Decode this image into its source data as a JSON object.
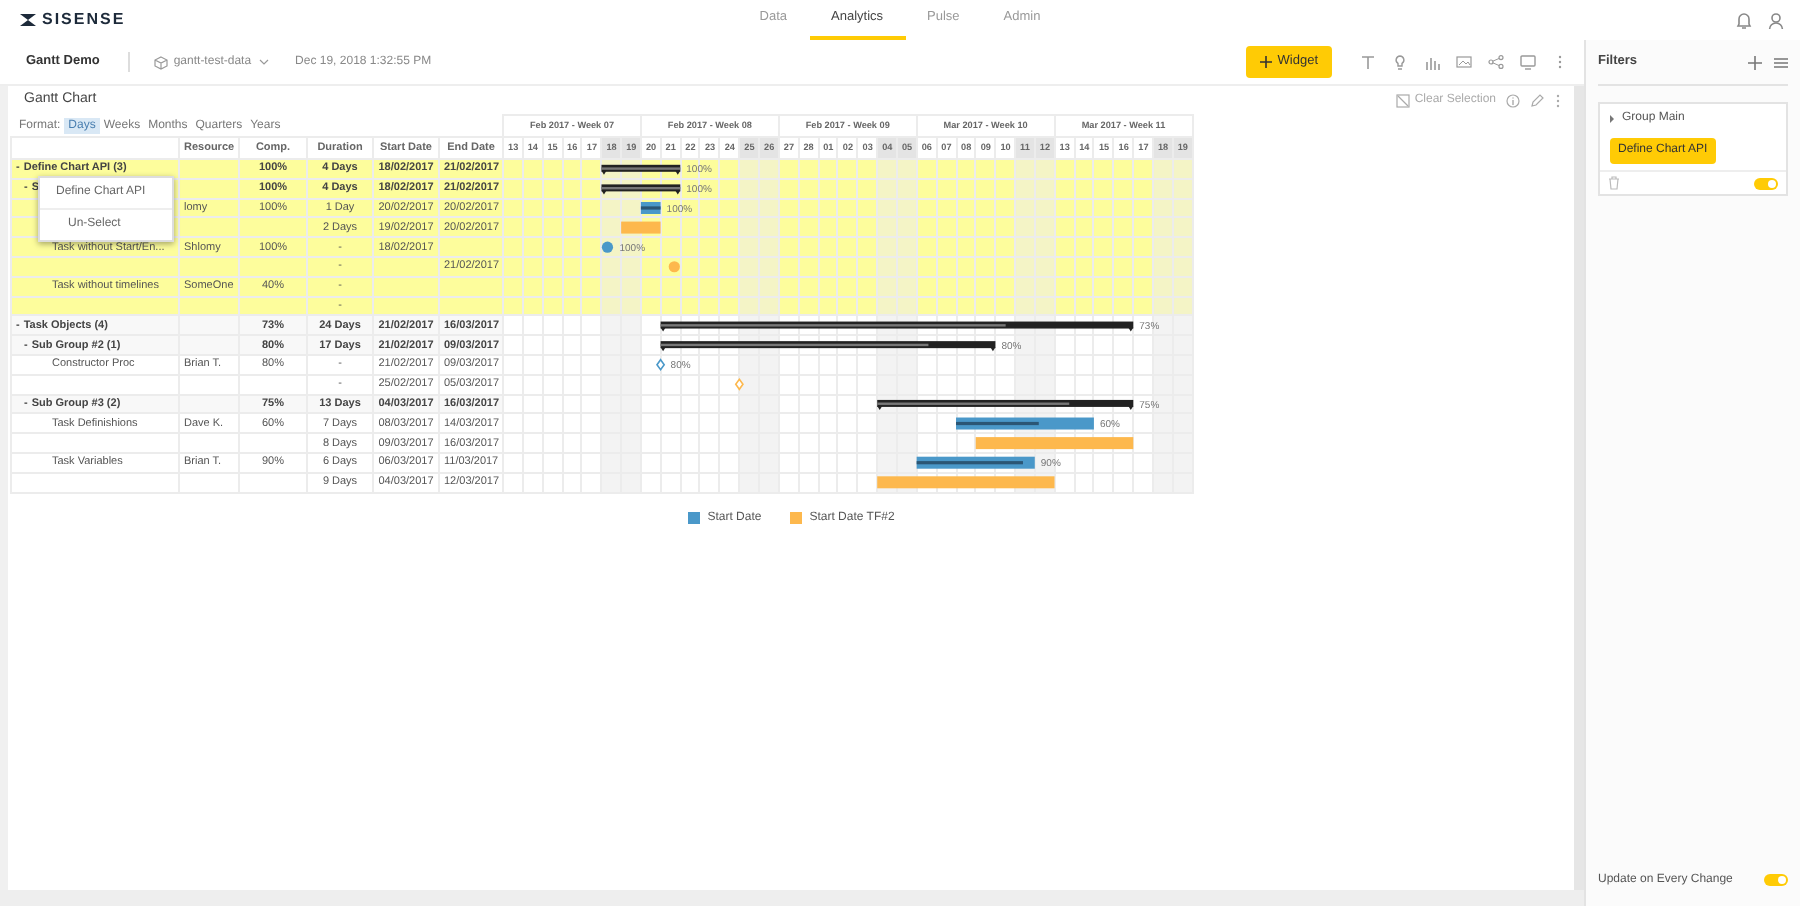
{
  "app": {
    "logo": "SISENSE",
    "nav": [
      {
        "label": "Data",
        "selected": false
      },
      {
        "label": "Analytics",
        "selected": true
      },
      {
        "label": "Pulse",
        "selected": false
      },
      {
        "label": "Admin",
        "selected": false
      }
    ]
  },
  "dashboard": {
    "title": "Gantt Demo",
    "datasource": "gantt-test-data",
    "updated": "Dec 19, 2018 1:32:55 PM",
    "add_button": "Widget"
  },
  "widget": {
    "title": "Gantt Chart",
    "clear_selection": "Clear Selection",
    "format_label": "Format:",
    "formats": [
      {
        "label": "Days",
        "selected": true
      },
      {
        "label": "Weeks",
        "selected": false
      },
      {
        "label": "Months",
        "selected": false
      },
      {
        "label": "Quarters",
        "selected": false
      },
      {
        "label": "Years",
        "selected": false
      }
    ],
    "columns": [
      "Resource",
      "Comp.",
      "Duration",
      "Start Date",
      "End Date"
    ],
    "weeks": [
      {
        "label": "Feb 2017 - Week 07",
        "days": [
          {
            "label": "13",
            "weekend": false
          },
          {
            "label": "14",
            "weekend": false
          },
          {
            "label": "15",
            "weekend": false
          },
          {
            "label": "16",
            "weekend": false
          },
          {
            "label": "17",
            "weekend": false
          },
          {
            "label": "18",
            "weekend": true
          },
          {
            "label": "19",
            "weekend": true
          }
        ]
      },
      {
        "label": "Feb 2017 - Week 08",
        "days": [
          {
            "label": "20",
            "weekend": false
          },
          {
            "label": "21",
            "weekend": false
          },
          {
            "label": "22",
            "weekend": false
          },
          {
            "label": "23",
            "weekend": false
          },
          {
            "label": "24",
            "weekend": false
          },
          {
            "label": "25",
            "weekend": true
          },
          {
            "label": "26",
            "weekend": true
          }
        ]
      },
      {
        "label": "Feb 2017 - Week 09",
        "days": [
          {
            "label": "27",
            "weekend": false
          },
          {
            "label": "28",
            "weekend": false
          },
          {
            "label": "01",
            "weekend": false
          },
          {
            "label": "02",
            "weekend": false
          },
          {
            "label": "03",
            "weekend": false
          },
          {
            "label": "04",
            "weekend": true
          },
          {
            "label": "05",
            "weekend": true
          }
        ]
      },
      {
        "label": "Mar 2017 - Week 10",
        "days": [
          {
            "label": "06",
            "weekend": false
          },
          {
            "label": "07",
            "weekend": false
          },
          {
            "label": "08",
            "weekend": false
          },
          {
            "label": "09",
            "weekend": false
          },
          {
            "label": "10",
            "weekend": false
          },
          {
            "label": "11",
            "weekend": true
          },
          {
            "label": "12",
            "weekend": true
          }
        ]
      },
      {
        "label": "Mar 2017 - Week 11",
        "days": [
          {
            "label": "13",
            "weekend": false
          },
          {
            "label": "14",
            "weekend": false
          },
          {
            "label": "15",
            "weekend": false
          },
          {
            "label": "16",
            "weekend": false
          },
          {
            "label": "17",
            "weekend": false
          },
          {
            "label": "18",
            "weekend": true
          },
          {
            "label": "19",
            "weekend": true
          }
        ]
      }
    ],
    "rows": [
      {
        "toggle": "-",
        "name": "Define Chart API (3)",
        "comp": "100%",
        "duration": "4 Days",
        "start": "18/02/2017",
        "end": "21/02/2017",
        "highlighted": true,
        "kind": "summary",
        "level": 1,
        "bar_label": "100%",
        "children": [
          {
            "toggle": "-",
            "name": "S",
            "comp": "100%",
            "duration": "4 Days",
            "start": "18/02/2017",
            "end": "21/02/2017",
            "highlighted": true,
            "kind": "summary",
            "level": 1,
            "bar_label": "100%",
            "children": [
              {
                "resource": "lomy",
                "comp": "100%",
                "duration": "1 Day",
                "start": "20/02/2017",
                "end": "20/02/2017",
                "highlighted": true,
                "kind": "bar",
                "color": "#4a98c9",
                "level": 1,
                "bar_label": "100%"
              },
              {
                "duration": "2 Days",
                "start": "19/02/2017",
                "end": "20/02/2017",
                "highlighted": true,
                "kind": "bar",
                "color": "#fdb84d"
              },
              {
                "name": "Task without Start/En...",
                "resource": "Shlomy",
                "comp": "100%",
                "duration": "-",
                "start": "18/02/2017",
                "highlighted": true,
                "kind": "dot",
                "color": "#4a98c9",
                "bar_label": "100%"
              },
              {
                "duration": "-",
                "end": "21/02/2017",
                "highlighted": true,
                "kind": "dot",
                "color": "#fdb84d"
              },
              {
                "name": "Task without timelines",
                "resource": "SomeOne",
                "comp": "40%",
                "duration": "-",
                "highlighted": true
              },
              {
                "duration": "-",
                "highlighted": true
              }
            ]
          }
        ]
      },
      {
        "toggle": "-",
        "name": "Task Objects (4)",
        "comp": "73%",
        "duration": "24 Days",
        "start": "21/02/2017",
        "end": "16/03/2017",
        "highlighted": false,
        "kind": "summary",
        "level": 0.73,
        "bar_label": "73%",
        "children": [
          {
            "toggle": "-",
            "name": "Sub Group #2 (1)",
            "comp": "80%",
            "duration": "17 Days",
            "start": "21/02/2017",
            "end": "09/03/2017",
            "highlighted": false,
            "kind": "summary",
            "level": 0.8,
            "bar_label": "80%",
            "children": [
              {
                "name": "Constructor Proc",
                "resource": "Brian T.",
                "comp": "80%",
                "duration": "-",
                "start": "21/02/2017",
                "end": "09/03/2017",
                "highlighted": false,
                "kind": "diamond",
                "color": "#4a98c9",
                "bar_label": "80%"
              },
              {
                "duration": "-",
                "start": "25/02/2017",
                "end": "05/03/2017",
                "highlighted": false,
                "kind": "diamond",
                "color": "#fdb84d"
              }
            ]
          },
          {
            "toggle": "-",
            "name": "Sub Group #3 (2)",
            "comp": "75%",
            "duration": "13 Days",
            "start": "04/03/2017",
            "end": "16/03/2017",
            "highlighted": false,
            "kind": "summary",
            "level": 0.75,
            "bar_label": "75%",
            "children": [
              {
                "name": "Task Definishions",
                "resource": "Dave K.",
                "comp": "60%",
                "duration": "7 Days",
                "start": "08/03/2017",
                "end": "14/03/2017",
                "highlighted": false,
                "kind": "bar",
                "color": "#4a98c9",
                "level": 0.6,
                "bar_label": "60%"
              },
              {
                "duration": "8 Days",
                "start": "09/03/2017",
                "end": "16/03/2017",
                "highlighted": false,
                "kind": "bar",
                "color": "#fdb84d"
              },
              {
                "name": "Task Variables",
                "resource": "Brian T.",
                "comp": "90%",
                "duration": "6 Days",
                "start": "06/03/2017",
                "end": "11/03/2017",
                "highlighted": false,
                "kind": "bar",
                "color": "#4a98c9",
                "level": 0.9,
                "bar_label": "90%"
              },
              {
                "duration": "9 Days",
                "start": "04/03/2017",
                "end": "12/03/2017",
                "highlighted": false,
                "kind": "bar",
                "color": "#fdb84d"
              }
            ]
          }
        ]
      }
    ],
    "legend": [
      {
        "label": "Start Date",
        "color": "#4a98c9"
      },
      {
        "label": "Start Date TF#2",
        "color": "#fdb84d"
      }
    ],
    "context_menu": [
      "Define Chart API",
      "Un-Select"
    ]
  },
  "filters": {
    "title": "Filters",
    "groups": [
      {
        "title": "Group Main",
        "chips": [
          "Define Chart API"
        ],
        "enabled": true
      }
    ],
    "update_label": "Update on Every Change",
    "update_on": true
  }
}
